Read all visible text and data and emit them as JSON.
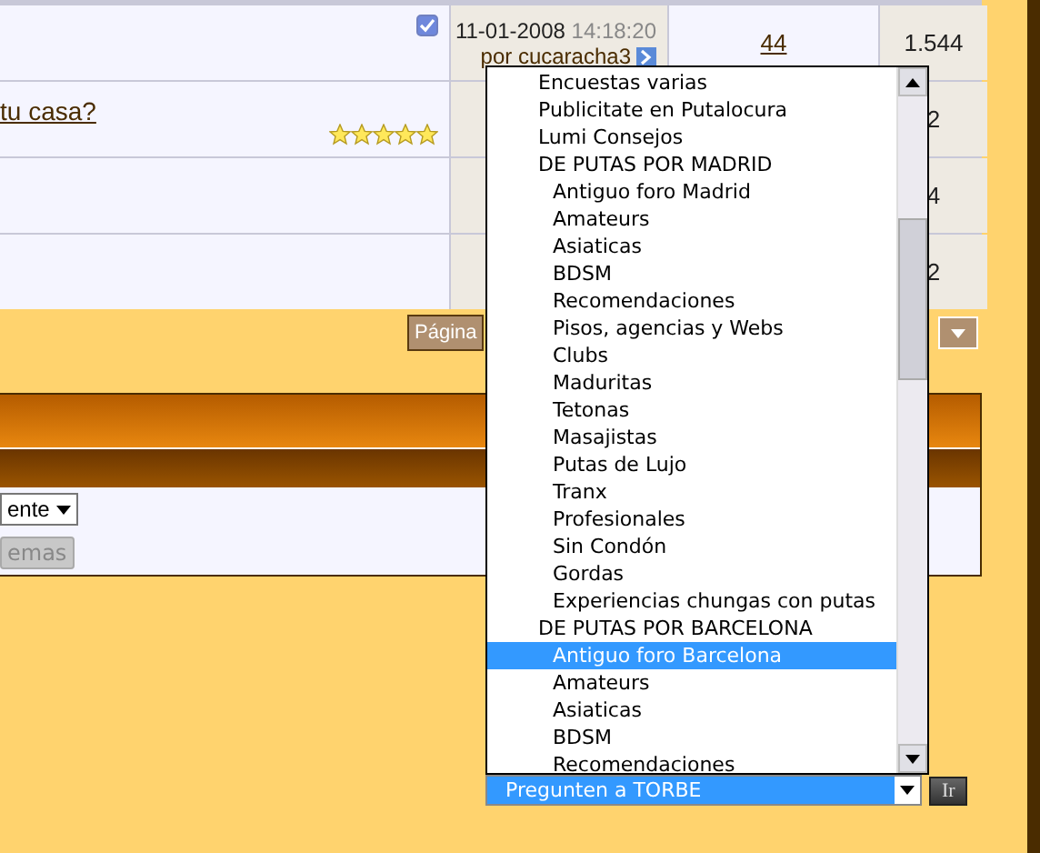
{
  "threads": [
    {
      "checked": true,
      "last_post": {
        "date": "11-01-2008",
        "time": "14:18:20",
        "author": "por cucaracha3"
      },
      "replies": "44",
      "views": "1.544"
    },
    {
      "title": "tu casa?",
      "stars": 5,
      "views": "2"
    },
    {
      "views": "4"
    },
    {
      "views": "2"
    }
  ],
  "pagination": {
    "label": "Página"
  },
  "sort_box": {
    "order_select": "ente",
    "show_button": "emas"
  },
  "forum_jump": {
    "options": [
      {
        "label": "Encuestas varias",
        "selected": false
      },
      {
        "label": "Publicitate en Putalocura",
        "selected": false
      },
      {
        "label": "Lumi Consejos",
        "selected": false
      },
      {
        "label": "DE PUTAS POR MADRID",
        "selected": false,
        "children": [
          {
            "label": "Antiguo foro Madrid",
            "selected": false
          },
          {
            "label": "Amateurs",
            "selected": false
          },
          {
            "label": "Asiaticas",
            "selected": false
          },
          {
            "label": "BDSM",
            "selected": false
          },
          {
            "label": "Recomendaciones",
            "selected": false
          },
          {
            "label": "Pisos, agencias y Webs",
            "selected": false
          },
          {
            "label": "Clubs",
            "selected": false
          },
          {
            "label": "Maduritas",
            "selected": false
          },
          {
            "label": "Tetonas",
            "selected": false
          },
          {
            "label": "Masajistas",
            "selected": false
          },
          {
            "label": "Putas de Lujo",
            "selected": false
          },
          {
            "label": "Tranx",
            "selected": false
          },
          {
            "label": "Profesionales",
            "selected": false
          },
          {
            "label": "Sin Condón",
            "selected": false
          },
          {
            "label": "Gordas",
            "selected": false
          },
          {
            "label": "Experiencias chungas con putas",
            "selected": false
          }
        ]
      },
      {
        "label": "DE PUTAS POR BARCELONA",
        "selected": false,
        "children": [
          {
            "label": "Antiguo foro Barcelona",
            "selected": true
          },
          {
            "label": "Amateurs",
            "selected": false
          },
          {
            "label": "Asiaticas",
            "selected": false
          },
          {
            "label": "BDSM",
            "selected": false
          },
          {
            "label": "Recomendaciones",
            "selected": false
          }
        ]
      }
    ],
    "current": "Pregunten a TORBE",
    "go_button": "Ir"
  }
}
